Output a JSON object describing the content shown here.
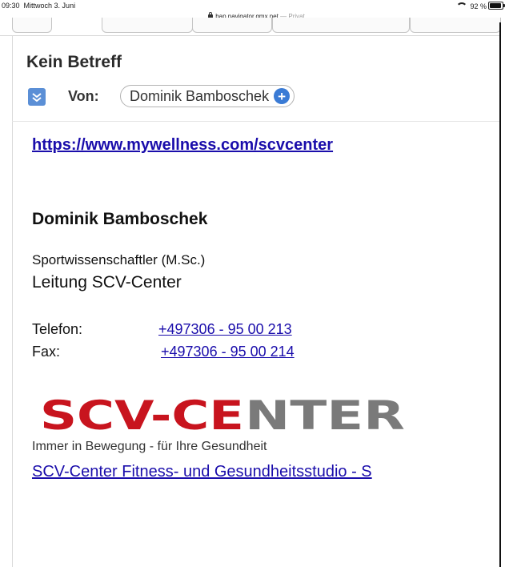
{
  "status_bar": {
    "time": "09:30",
    "date": "Mittwoch 3. Juni",
    "url": "bap.navigator.gmx.net",
    "mode": "— Privat",
    "battery": "92 %",
    "battery_level": 0.92
  },
  "message": {
    "subject": "Kein Betreff",
    "from_label": "Von:",
    "sender": "Dominik Bamboschek"
  },
  "body": {
    "link_main": "https://www.mywellness.com/scvcenter",
    "signature": {
      "name": "Dominik Bamboschek",
      "title": "Sportwissenschaftler (M.Sc.)",
      "role": "Leitung SCV-Center",
      "phone_label": "Telefon:",
      "phone": "+497306 - 95 00 213",
      "fax_label": "Fax:",
      "fax": "+497306 - 95 00 214"
    },
    "logo": {
      "text": "SCV-CENTER",
      "tagline": "Immer in Bewegung - für Ihre Gesundheit",
      "colors": {
        "red": "#c8141e",
        "gray": "#7a7a7a"
      }
    },
    "link_studio": "SCV-Center Fitness- und Gesundheitsstudio - S"
  },
  "icons": {
    "expand": "expand-chevron-icon",
    "add_contact": "plus-circle-icon",
    "lock": "lock-icon",
    "wifi": "wifi-icon",
    "battery": "battery-icon"
  },
  "colors": {
    "link": "#1a0dab",
    "accent": "#3a7bd5"
  }
}
